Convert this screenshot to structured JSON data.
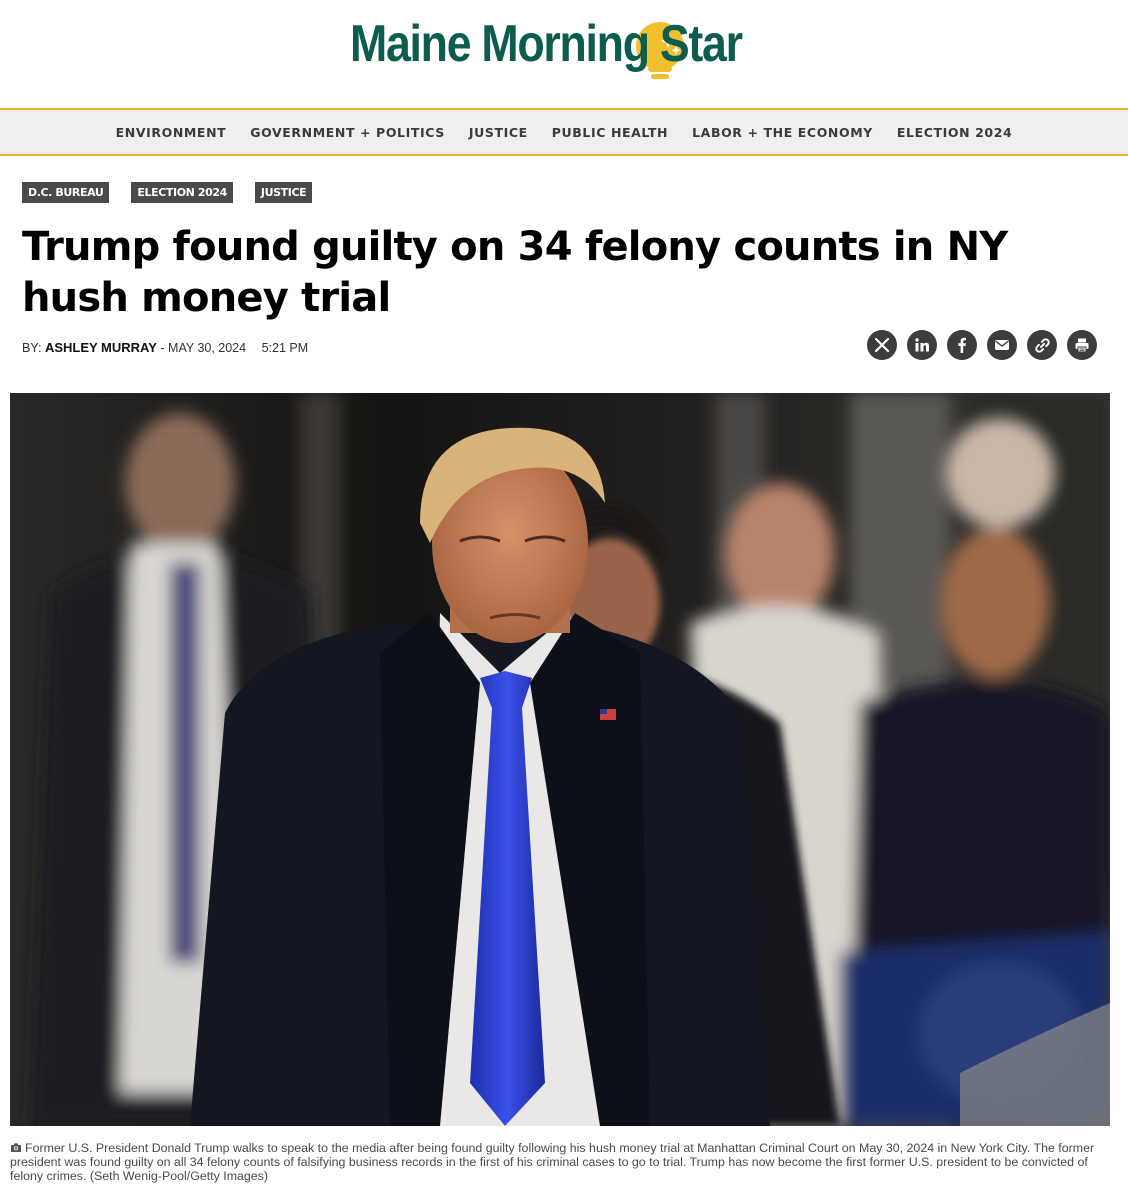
{
  "site": {
    "logo_text": "Maine Morning Star"
  },
  "nav": {
    "items": [
      "ENVIRONMENT",
      "GOVERNMENT + POLITICS",
      "JUSTICE",
      "PUBLIC HEALTH",
      "LABOR + THE ECONOMY",
      "ELECTION 2024"
    ]
  },
  "article": {
    "tags": [
      "D.C. BUREAU",
      "ELECTION 2024",
      "JUSTICE"
    ],
    "headline": "Trump found guilty on 34 felony counts in NY hush money trial",
    "byline_prefix": "BY:",
    "author": "ASHLEY MURRAY",
    "date": "- MAY 30, 2024",
    "time": "5:21 PM",
    "share_icons": [
      "x-icon",
      "linkedin-icon",
      "facebook-icon",
      "email-icon",
      "link-icon",
      "print-icon"
    ],
    "caption": "Former U.S. President Donald Trump walks to speak to the media after being found guilty following his hush money trial at Manhattan Criminal Court on May 30, 2024 in New York City. The former president was found guilty on all 34 felony counts of falsifying business records in the first of his criminal cases to go to trial. Trump has now become the first former U.S. president to be convicted of felony crimes. (Seth Wenig-Pool/Getty Images)"
  },
  "colors": {
    "brand_green": "#0d5c4f",
    "brand_gold": "#e4b82a",
    "tag_bg": "#4a4a4a",
    "share_bg": "#3c3c3c"
  }
}
